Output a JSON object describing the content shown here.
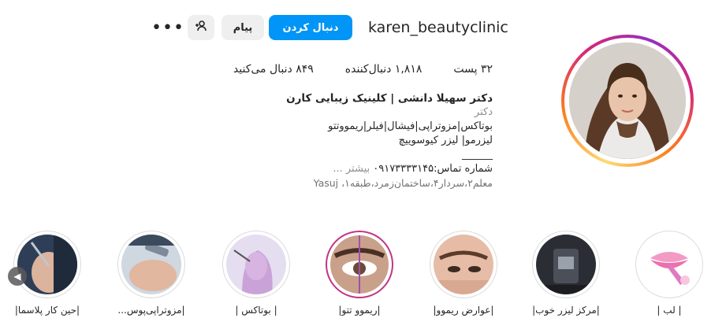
{
  "profile": {
    "username": "karen_beautyclinic",
    "follow_label": "دنبال کردن",
    "message_label": "پیام",
    "more_label": "•••"
  },
  "stats": {
    "posts": "۳۲ پست",
    "followers": "۱,۸۱۸ دنبال‌کننده",
    "following": "۸۴۹ دنبال می‌کنید"
  },
  "bio": {
    "name": "دکتر سهیلا دانشی | کلینیک زیبایی کارن",
    "category": "دکتر",
    "line1": "بوتاکس|مزوتراپی|فیشال|فیلر|ریموو‌تتو",
    "line2": "لیزرمو| لیزر کیوسوییچ",
    "line3": "______",
    "line4": "شماره تماس:۰۹۱۷۳۳۳۳۱۴۵",
    "more_label": "بیشتر ...",
    "address": "معلم۲،سردار۴،ساختمان‌زمرد،طبقه۱، Yasuj"
  },
  "highlights": [
    {
      "label": "| لب |"
    },
    {
      "label": "|مرکز لیزر خوب|"
    },
    {
      "label": "|عوارض ریموو|"
    },
    {
      "label": "|ریموو تتو|"
    },
    {
      "label": "| بوتاکس |"
    },
    {
      "label": "|مزوتراپی‌پوس..."
    },
    {
      "label": "|حین کار پلاسما|"
    }
  ],
  "colors": {
    "follow_button": "#0095f6",
    "highlight_active_ring": "#c13584"
  }
}
